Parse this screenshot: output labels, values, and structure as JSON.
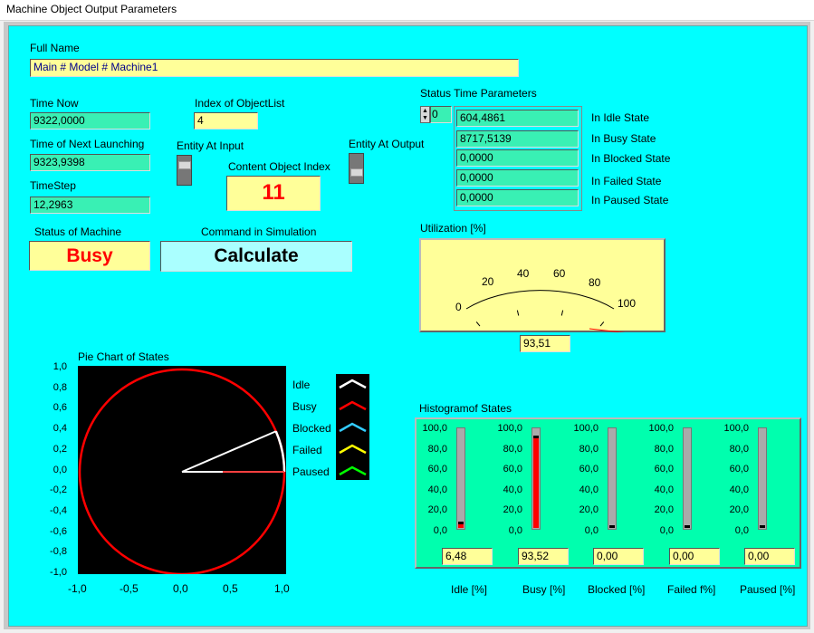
{
  "window": {
    "title": "Machine Object Output Parameters"
  },
  "full_name": {
    "label": "Full Name",
    "value": "Main # Model # Machine1"
  },
  "time_now": {
    "label": "Time Now",
    "value": "9322,0000"
  },
  "next_launching": {
    "label": "Time of Next Launching",
    "value": "9323,9398"
  },
  "timestep": {
    "label": "TimeStep",
    "value": "12,2963"
  },
  "index_objectlist": {
    "label": "Index of ObjectList",
    "value": "4"
  },
  "entity_input": {
    "label": "Entity At Input"
  },
  "entity_output": {
    "label": "Entity At Output"
  },
  "content_index": {
    "label": "Content Object Index",
    "value": "11"
  },
  "status_machine": {
    "label": "Status of Machine",
    "value": "Busy"
  },
  "command": {
    "label": "Command in Simulation",
    "value": "Calculate"
  },
  "status_time": {
    "label": "Status Time Parameters",
    "spinner_value": "0",
    "rows": [
      {
        "value": "604,4861",
        "label": "In Idle State"
      },
      {
        "value": "8717,5139",
        "label": "In Busy State"
      },
      {
        "value": "0,0000",
        "label": "In Blocked State"
      },
      {
        "value": "0,0000",
        "label": "In Failed State"
      },
      {
        "value": "0,0000",
        "label": "In Paused State"
      }
    ]
  },
  "utilization": {
    "label": "Utilization [%]",
    "value": "93,51",
    "percent": 93.51,
    "scale": [
      "0",
      "20",
      "40",
      "60",
      "80",
      "100"
    ],
    "needle_color": "#ff0000"
  },
  "pie": {
    "title": "Pie Chart of States",
    "x_ticks": [
      "-1,0",
      "-0,5",
      "0,0",
      "0,5",
      "1,0"
    ],
    "y_ticks": [
      "1,0",
      "0,8",
      "0,6",
      "0,4",
      "0,2",
      "0,0",
      "-0,2",
      "-0,4",
      "-0,6",
      "-0,8",
      "-1,0"
    ],
    "legend": [
      {
        "name": "Idle",
        "color": "#ffffff"
      },
      {
        "name": "Busy",
        "color": "#ff0000"
      },
      {
        "name": "Blocked",
        "color": "#33ccff"
      },
      {
        "name": "Failed",
        "color": "#ffff00"
      },
      {
        "name": "Paused",
        "color": "#00ff00"
      }
    ]
  },
  "histogram": {
    "title": "Histogramof States",
    "ticks": [
      "100,0",
      "80,0",
      "60,0",
      "40,0",
      "20,0",
      "0,0"
    ],
    "items": [
      {
        "name": "Idle [%]",
        "value": "6,48",
        "percent": 6.48
      },
      {
        "name": "Busy [%]",
        "value": "93,52",
        "percent": 93.52
      },
      {
        "name": "Blocked [%]",
        "value": "0,00",
        "percent": 0
      },
      {
        "name": "Failed f%]",
        "value": "0,00",
        "percent": 0
      },
      {
        "name": "Paused [%]",
        "value": "0,00",
        "percent": 0
      }
    ],
    "fill_color": "#ff0000"
  }
}
